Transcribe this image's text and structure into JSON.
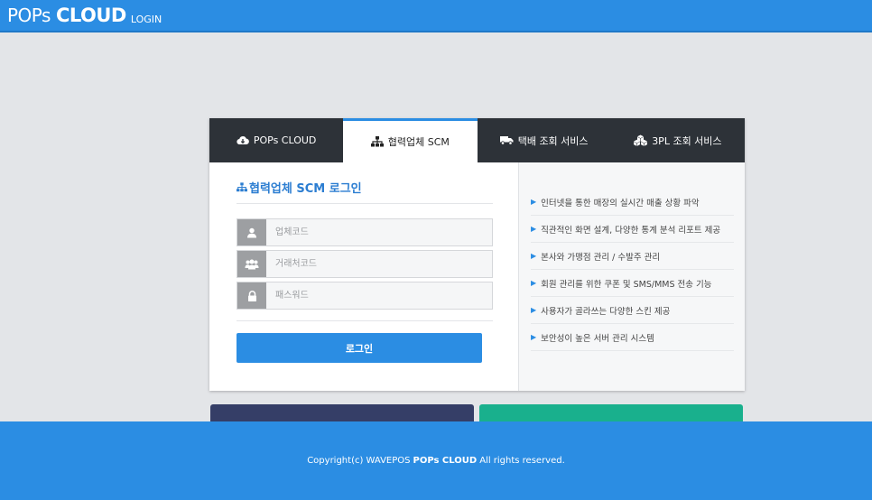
{
  "header": {
    "brand_prefix": "POPs",
    "brand_bold": "CLOUD",
    "brand_sub": "LOGIN"
  },
  "tabs": [
    {
      "label": "POPs CLOUD",
      "icon": "cloud-download-icon",
      "active": false
    },
    {
      "label": "협력업체 SCM",
      "icon": "sitemap-icon",
      "active": true
    },
    {
      "label": "택배 조회 서비스",
      "icon": "truck-icon",
      "active": false
    },
    {
      "label": "3PL 조회 서비스",
      "icon": "cubes-icon",
      "active": false
    }
  ],
  "login": {
    "title": "협력업체 SCM 로그인",
    "fields": [
      {
        "placeholder": "업체코드",
        "icon": "user-icon"
      },
      {
        "placeholder": "거래처코드",
        "icon": "users-icon"
      },
      {
        "placeholder": "패스워드",
        "icon": "lock-icon"
      }
    ],
    "button_label": "로그인"
  },
  "features": [
    "인터넷을 통한 매장의 실시간 매출 상황 파악",
    "직관적인 화면 설계, 다양한 통계 분석 리포트 제공",
    "본사와 가맹점 관리 / 수발주 관리",
    "회원 관리를 위한 쿠폰 및 SMS/MMS 전송 기능",
    "사용자가 골라쓰는 다양한 스킨 제공",
    "보안성이 높은 서버 관리 시스템"
  ],
  "footer": {
    "prefix": "Copyright(c) WAVEPOS",
    "brand": "POPs CLOUD",
    "suffix": "All rights reserved."
  },
  "colors": {
    "primary": "#2b8de3",
    "tab_bar": "#2d3238",
    "card_dark": "#353e67",
    "card_green": "#19b08d"
  }
}
